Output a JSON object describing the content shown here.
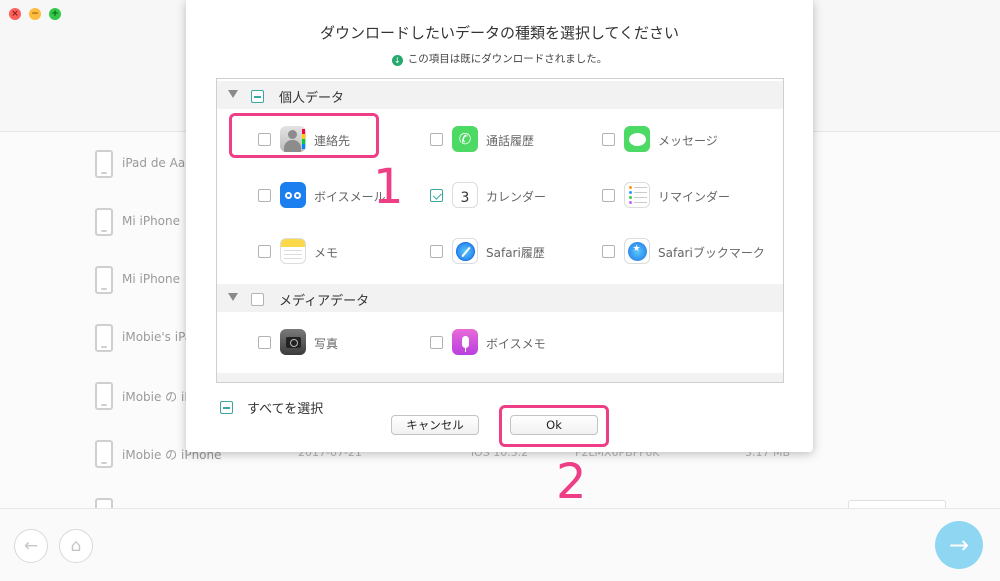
{
  "window": {
    "devices": [
      {
        "name": "iPad de Aaron",
        "date": "",
        "ios": "",
        "serial": "",
        "size": ""
      },
      {
        "name": "Mi iPhone",
        "date": "",
        "ios": "",
        "serial": "",
        "size": ""
      },
      {
        "name": "Mi iPhone",
        "date": "",
        "ios": "",
        "serial": "",
        "size": ""
      },
      {
        "name": "iMobie's iPad",
        "date": "",
        "ios": "",
        "serial": "",
        "size": ""
      },
      {
        "name": "iMobie の iPhone",
        "date": "",
        "ios": "",
        "serial": "",
        "size": ""
      },
      {
        "name": "iMobie の iPhone",
        "date": "2017-07-21",
        "ios": "iOS 10.3.2",
        "serial": "F2LMX6PBFF6K",
        "size": "3.17 MB"
      }
    ],
    "back_icon": "arrow-left-icon",
    "home_icon": "home-icon",
    "next_icon": "arrow-right-icon"
  },
  "dialog": {
    "title": "ダウンロードしたいデータの種類を選択してください",
    "subtitle": "この項目は既にダウンロードされました。",
    "sections": [
      {
        "label": "個人データ",
        "state": "partial",
        "items": [
          {
            "label": "連絡先",
            "checked": false,
            "icon": "contacts-icon"
          },
          {
            "label": "通話履歴",
            "checked": false,
            "icon": "phone-icon"
          },
          {
            "label": "メッセージ",
            "checked": false,
            "icon": "messages-icon"
          },
          {
            "label": "ボイスメール",
            "checked": false,
            "icon": "voicemail-icon"
          },
          {
            "label": "カレンダー",
            "checked": true,
            "icon": "calendar-icon"
          },
          {
            "label": "リマインダー",
            "checked": false,
            "icon": "reminders-icon"
          },
          {
            "label": "メモ",
            "checked": false,
            "icon": "notes-icon"
          },
          {
            "label": "Safari履歴",
            "checked": false,
            "icon": "safari-icon"
          },
          {
            "label": "Safariブックマーク",
            "checked": false,
            "icon": "safari-bookmark-icon"
          }
        ]
      },
      {
        "label": "メディアデータ",
        "state": "unchecked",
        "items": [
          {
            "label": "写真",
            "checked": false,
            "icon": "camera-icon"
          },
          {
            "label": "ボイスメモ",
            "checked": false,
            "icon": "voice-memo-icon"
          }
        ]
      }
    ],
    "calendar_icon_day": "3",
    "select_all_label": "すべてを選択",
    "cancel_label": "キャンセル",
    "ok_label": "Ok"
  },
  "annotations": {
    "one": "1",
    "two": "2",
    "color": "#ee3f86"
  }
}
